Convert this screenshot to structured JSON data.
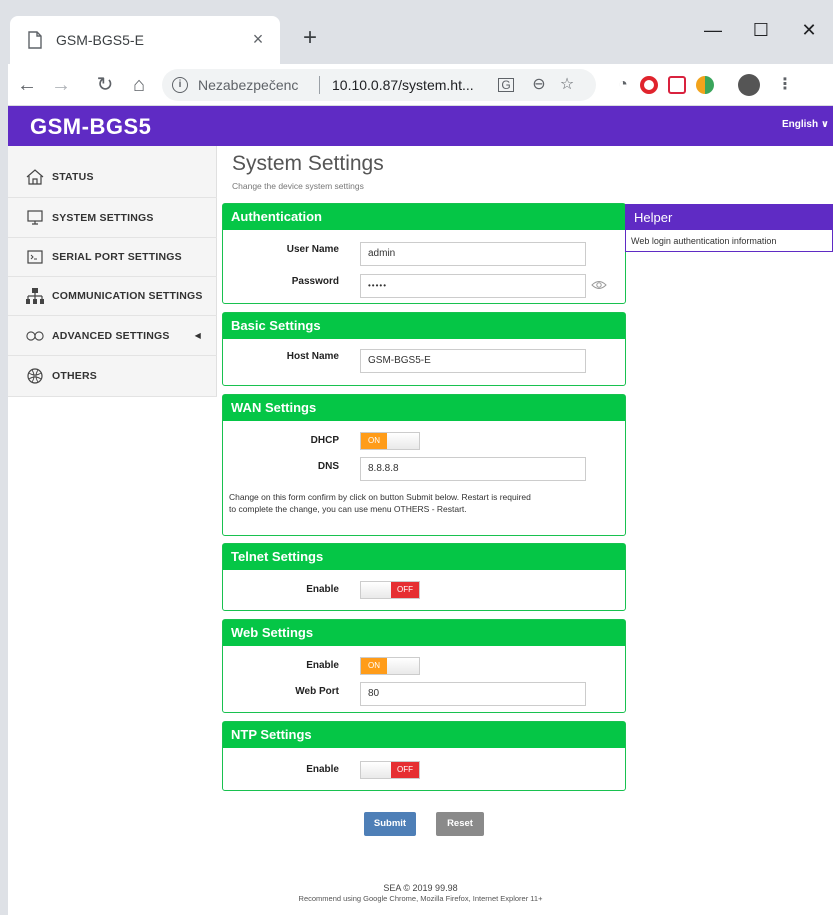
{
  "browser": {
    "tab_title": "GSM-BGS5-E",
    "tab_close": "×",
    "new_tab": "+",
    "security_label": "Nezabezpečenc",
    "url": "10.10.0.87/system.ht...",
    "window_minimize": "—",
    "window_maximize": "☐",
    "window_close": "✕"
  },
  "header": {
    "brand": "GSM-BGS5",
    "language": "English ∨"
  },
  "sidebar": {
    "items": [
      {
        "label": "STATUS",
        "icon": "home-icon"
      },
      {
        "label": "SYSTEM SETTINGS",
        "icon": "monitor-icon"
      },
      {
        "label": "SERIAL PORT SETTINGS",
        "icon": "terminal-icon"
      },
      {
        "label": "COMMUNICATION SETTINGS",
        "icon": "network-icon"
      },
      {
        "label": "ADVANCED SETTINGS",
        "icon": "infinity-icon"
      },
      {
        "label": "OTHERS",
        "icon": "globe-icon"
      }
    ]
  },
  "page": {
    "title": "System Settings",
    "subtitle": "Change the device system settings"
  },
  "authentication": {
    "heading": "Authentication",
    "user_name_label": "User Name",
    "user_name_value": "admin",
    "password_label": "Password",
    "password_value": "•••••"
  },
  "basic": {
    "heading": "Basic Settings",
    "host_name_label": "Host Name",
    "host_name_value": "GSM-BGS5-E"
  },
  "wan": {
    "heading": "WAN Settings",
    "dhcp_label": "DHCP",
    "dhcp_state": "ON",
    "dns_label": "DNS",
    "dns_value": "8.8.8.8",
    "note_line1": "Change on this form confirm by click on button Submit below. Restart is required",
    "note_line2": "to complete the change, you can use menu OTHERS - Restart."
  },
  "telnet": {
    "heading": "Telnet Settings",
    "enable_label": "Enable",
    "enable_state": "OFF"
  },
  "web": {
    "heading": "Web Settings",
    "enable_label": "Enable",
    "enable_state": "ON",
    "port_label": "Web Port",
    "port_value": "80"
  },
  "ntp": {
    "heading": "NTP Settings",
    "enable_label": "Enable",
    "enable_state": "OFF"
  },
  "helper": {
    "heading": "Helper",
    "text": "Web login authentication information"
  },
  "buttons": {
    "submit": "Submit",
    "reset": "Reset"
  },
  "footer": {
    "line1": "SEA © 2019 99.98",
    "line2": "Recommend using Google Chrome, Mozilla Firefox, Internet Explorer 11+"
  },
  "colors": {
    "header_bg": "#5f2bc4",
    "panel_head": "#05c646",
    "toggle_on": "#ff9c19",
    "toggle_off": "#e62f32",
    "submit_btn": "#4e7fb7",
    "reset_btn": "#8a8a8a"
  }
}
